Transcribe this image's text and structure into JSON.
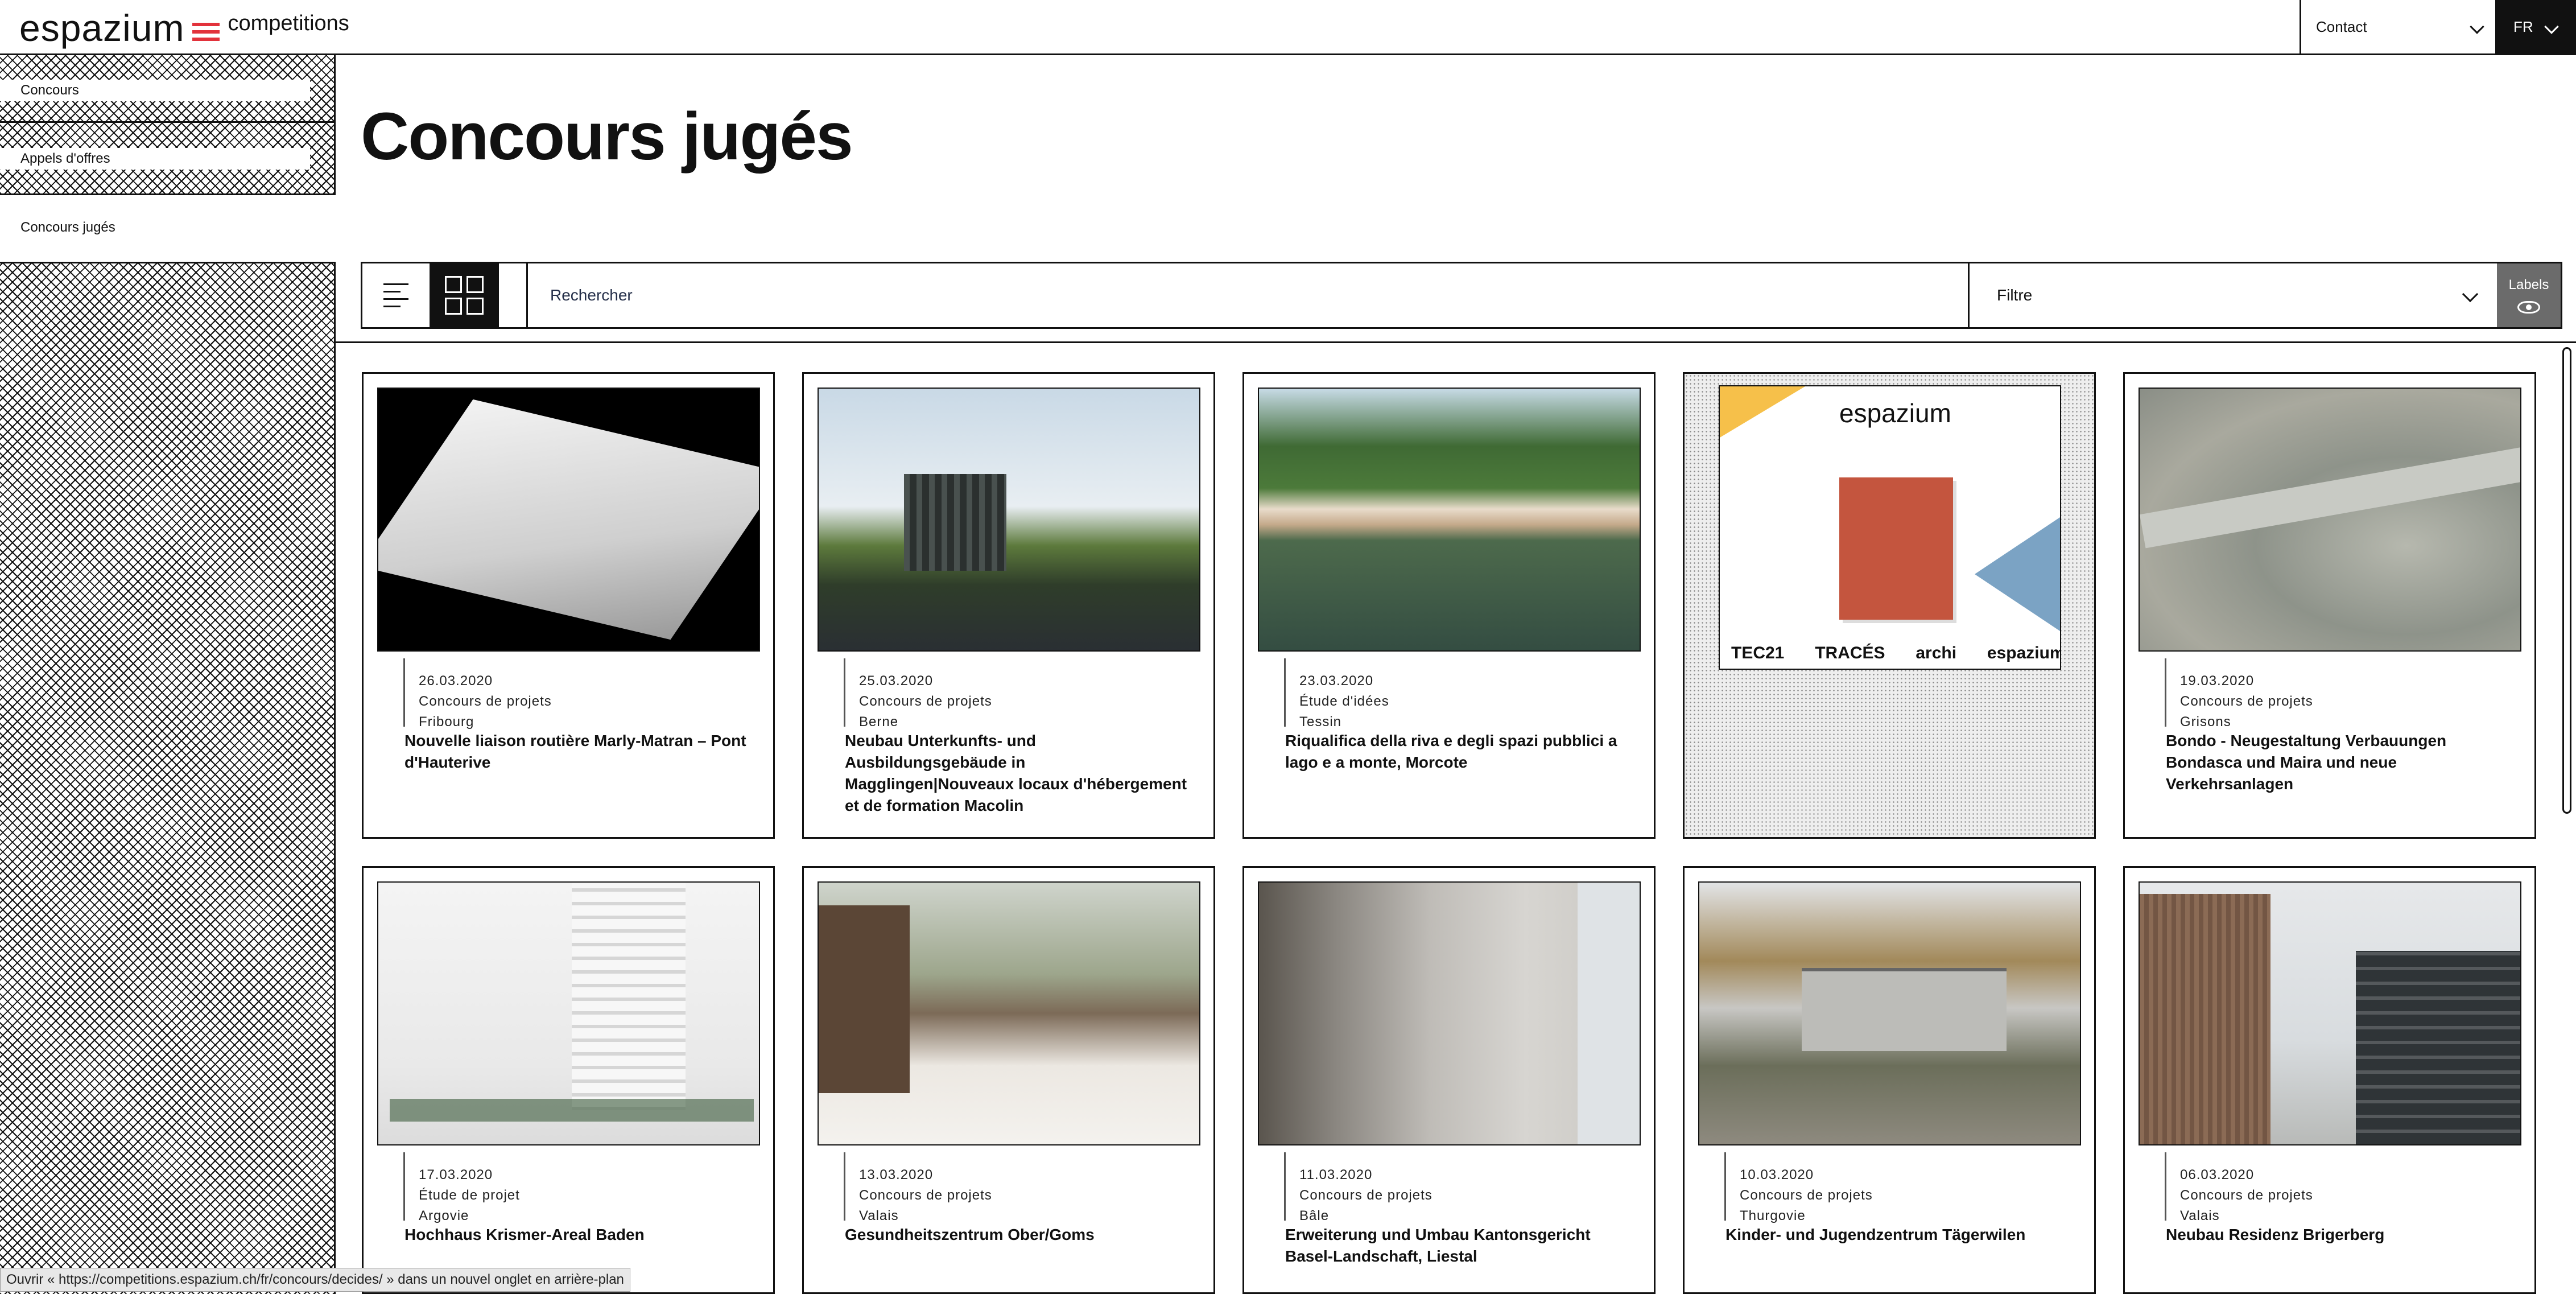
{
  "header": {
    "logo_word": "espazium",
    "logo_sub": "competitions",
    "contact_label": "Contact",
    "lang_label": "FR",
    "brand_color": "#e2323b"
  },
  "sidebar": {
    "items": [
      {
        "label": "Concours"
      },
      {
        "label": "Appels d'offres"
      },
      {
        "label": "Concours jugés"
      }
    ]
  },
  "page": {
    "title": "Concours jugés"
  },
  "toolbar": {
    "search_placeholder": "Rechercher",
    "filter_label": "Filtre",
    "labels_button": "Labels"
  },
  "cards": [
    {
      "date": "26.03.2020",
      "type": "Concours de projets",
      "region": "Fribourg",
      "title": "Nouvelle liaison routière Marly-Matran – Pont d'Hauterive"
    },
    {
      "date": "25.03.2020",
      "type": "Concours de projets",
      "region": "Berne",
      "title": "Neubau Unterkunfts- und Ausbildungsgebäude in Magglingen|Nouveaux locaux d'hébergement et de formation Macolin"
    },
    {
      "date": "23.03.2020",
      "type": "Étude d'idées",
      "region": "Tessin",
      "title": "Riqualifica della riva e degli spazi pubblici a lago e a monte, Morcote"
    },
    {
      "ad": {
        "word": "espazium",
        "brands": [
          "TEC21",
          "TRACÉS",
          "archi",
          "espazium.ch"
        ]
      }
    },
    {
      "date": "19.03.2020",
      "type": "Concours de projets",
      "region": "Grisons",
      "title": "Bondo - Neugestaltung Verbauungen Bondasca und Maira und neue Verkehrsanlagen"
    },
    {
      "date": "17.03.2020",
      "type": "Étude de projet",
      "region": "Argovie",
      "title": "Hochhaus Krismer-Areal Baden"
    },
    {
      "date": "13.03.2020",
      "type": "Concours de projets",
      "region": "Valais",
      "title": "Gesundheitszentrum Ober/Goms"
    },
    {
      "date": "11.03.2020",
      "type": "Concours de projets",
      "region": "Bâle",
      "title": "Erweiterung und Umbau Kantonsgericht Basel-Landschaft, Liestal"
    },
    {
      "date": "10.03.2020",
      "type": "Concours de projets",
      "region": "Thurgovie",
      "title": "Kinder- und Jugendzentrum Tägerwilen"
    },
    {
      "date": "06.03.2020",
      "type": "Concours de projets",
      "region": "Valais",
      "title": "Neubau Residenz Brigerberg"
    }
  ],
  "statusbar": {
    "text": "Ouvrir « https://competitions.espazium.ch/fr/concours/decides/ » dans un nouvel onglet en arrière-plan"
  }
}
